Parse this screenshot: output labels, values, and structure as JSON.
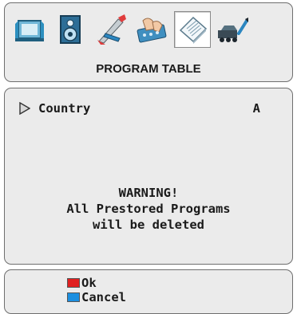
{
  "menu": {
    "icons": [
      {
        "name": "picture-icon"
      },
      {
        "name": "sound-icon"
      },
      {
        "name": "tools-icon"
      },
      {
        "name": "features-icon"
      },
      {
        "name": "program-table-icon",
        "selected": true
      },
      {
        "name": "installation-icon"
      }
    ],
    "title": "PROGRAM TABLE"
  },
  "content": {
    "selected_row": {
      "label": "Country",
      "value": "A"
    },
    "warning_lines": [
      "WARNING!",
      "All Prestored Programs",
      "will be deleted"
    ]
  },
  "footer": {
    "ok": {
      "label": "Ok",
      "color": "#e02020"
    },
    "cancel": {
      "label": "Cancel",
      "color": "#1c8fe0"
    }
  }
}
